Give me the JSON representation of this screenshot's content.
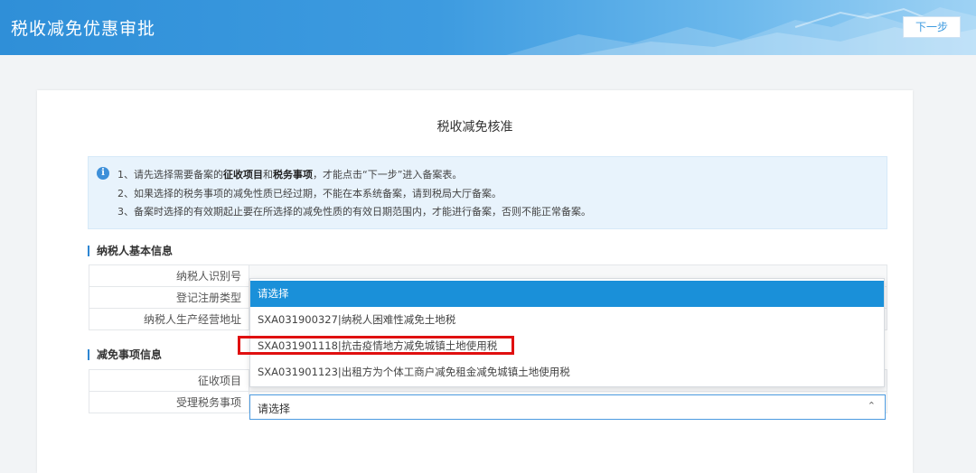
{
  "header": {
    "title": "税收减免优惠审批",
    "next_label": "下一步"
  },
  "panel": {
    "title": "税收减免核准",
    "notice": {
      "line1_a": "1、请先选择需要备案的",
      "line1_b": "征收项目",
      "line1_c": "和",
      "line1_d": "税务事项",
      "line1_e": "，才能点击“下一步”进入备案表。",
      "line2": "2、如果选择的税务事项的减免性质已经过期，不能在本系统备案，请到税局大厅备案。",
      "line3": "3、备案时选择的有效期起止要在所选择的减免性质的有效日期范围内，才能进行备案，否则不能正常备案。"
    },
    "taxpayer": {
      "section_title": "纳税人基本信息",
      "id_label": "纳税人识别号",
      "reg_type_label": "登记注册类型",
      "address_label": "纳税人生产经营地址"
    },
    "exemption": {
      "section_title": "减免事项信息",
      "levy_label": "征收项目",
      "matter_label": "受理税务事项",
      "matter_value": "请选择"
    }
  },
  "dropdown": {
    "options": [
      "请选择",
      "SXA031900327|纳税人困难性减免土地税",
      "SXA031901118|抗击疫情地方减免城镇土地使用税",
      "SXA031901123|出租方为个体工商户减免租金减免城镇土地使用税"
    ],
    "selected_index": 0,
    "highlighted_index": 2,
    "highlight_color": "#e01010"
  }
}
